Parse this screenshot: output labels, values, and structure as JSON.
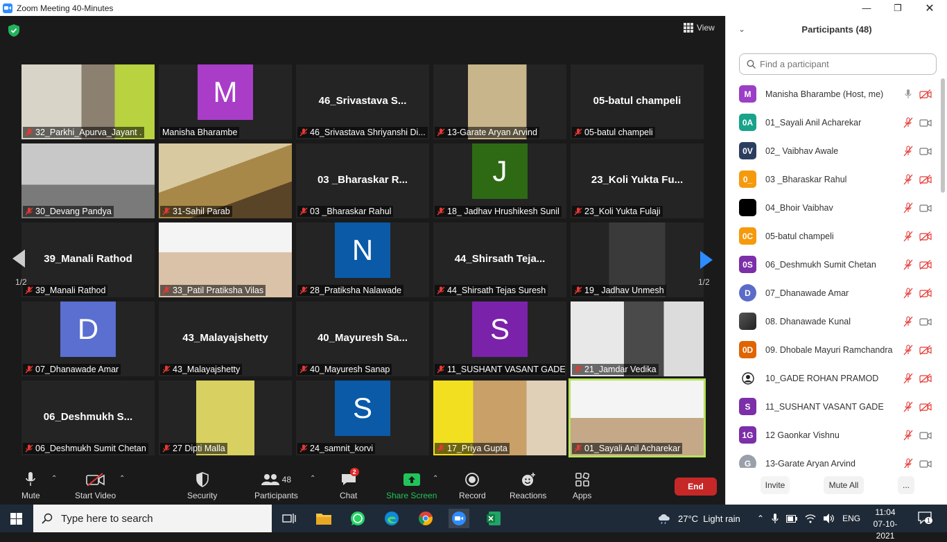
{
  "window": {
    "title": "Zoom Meeting 40-Minutes"
  },
  "view_label": "View",
  "page_indicator": "1/2",
  "tiles": [
    {
      "caption": "32_Parkhi_Apurva_Jayant ."
    },
    {
      "caption": "Manisha Bharambe",
      "initial": "M"
    },
    {
      "caption": "46_Srivastava Shriyanshi Di...",
      "big": "46_Srivastava  S..."
    },
    {
      "caption": "13-Garate Aryan Arvind"
    },
    {
      "caption": "05-batul champeli",
      "big": "05-batul champeli"
    },
    {
      "caption": "30_Devang Pandya"
    },
    {
      "caption": "31-Sahil Parab"
    },
    {
      "caption": "03 _Bharaskar Rahul",
      "big": "03 _Bharaskar R..."
    },
    {
      "caption": "18_ Jadhav Hrushikesh Sunil",
      "initial": "J"
    },
    {
      "caption": "23_Koli Yukta Fulaji",
      "big": "23_Koli Yukta Fu..."
    },
    {
      "caption": "39_Manali Rathod",
      "big": "39_Manali Rathod"
    },
    {
      "caption": "33_Patil Pratiksha Vilas"
    },
    {
      "caption": "28_Pratiksha Nalawade",
      "initial": "N"
    },
    {
      "caption": "44_Shirsath Tejas Suresh",
      "big": "44_Shirsath  Teja..."
    },
    {
      "caption": "19_ Jadhav Unmesh"
    },
    {
      "caption": "07_Dhanawade Amar",
      "initial": "D"
    },
    {
      "caption": "43_Malayajshetty",
      "big": "43_Malayajshetty"
    },
    {
      "caption": "40_Mayuresh Sanap",
      "big": "40_Mayuresh  Sa..."
    },
    {
      "caption": "11_SUSHANT VASANT GADE",
      "initial": "S"
    },
    {
      "caption": "21_Jamdar Vedika"
    },
    {
      "caption": "06_Deshmukh Sumit Chetan",
      "big": "06_Deshmukh  S..."
    },
    {
      "caption": "27 Dipti Malla"
    },
    {
      "caption": "24_samnit_korvi",
      "initial": "S"
    },
    {
      "caption": "17_Priya Gupta"
    },
    {
      "caption": "01_Sayali Anil Acharekar"
    }
  ],
  "toolbar": {
    "mute": "Mute",
    "start_video": "Start Video",
    "security": "Security",
    "participants": "Participants",
    "participants_count": "48",
    "chat": "Chat",
    "chat_badge": "2",
    "share_screen": "Share Screen",
    "record": "Record",
    "reactions": "Reactions",
    "apps": "Apps",
    "end": "End"
  },
  "panel": {
    "title": "Participants (48)",
    "search_placeholder": "Find a participant",
    "invite": "Invite",
    "mute_all": "Mute All",
    "more": "...",
    "participants": [
      {
        "initials": "M",
        "name": "Manisha Bharambe (Host, me)",
        "color": "#9b3fc6"
      },
      {
        "initials": "0A",
        "name": "01_Sayali Anil Acharekar",
        "color": "#18a38a"
      },
      {
        "initials": "0V",
        "name": "02_ Vaibhav Awale",
        "color": "#2c3e60"
      },
      {
        "initials": "0_",
        "name": "03 _Bharaskar Rahul",
        "color": "#f59a0c"
      },
      {
        "initials": "",
        "name": "04_Bhoir Vaibhav",
        "color": "#000000"
      },
      {
        "initials": "0C",
        "name": "05-batul champeli",
        "color": "#f59a0c"
      },
      {
        "initials": "0S",
        "name": "06_Deshmukh Sumit Chetan",
        "color": "#7b2fa8"
      },
      {
        "initials": "D",
        "name": "07_Dhanawade Amar",
        "color": "#5b6bc8"
      },
      {
        "initials": "",
        "name": "08. Dhanawade Kunal",
        "color": "#444444"
      },
      {
        "initials": "0D",
        "name": "09. Dhobale Mayuri Ramchandra",
        "color": "#e06400"
      },
      {
        "initials": "",
        "name": "10_GADE ROHAN PRAMOD",
        "color": "#ffffff"
      },
      {
        "initials": "S",
        "name": "11_SUSHANT VASANT GADE",
        "color": "#7b2fa8"
      },
      {
        "initials": "1G",
        "name": "12 Gaonkar Vishnu",
        "color": "#7b2fa8"
      },
      {
        "initials": "G",
        "name": "13-Garate Aryan Arvind",
        "color": "#9aa0aa"
      }
    ]
  },
  "taskbar": {
    "search_placeholder": "Type here to search",
    "weather": "27°C  Light rain",
    "lang": "ENG",
    "time": "11:04",
    "date": "07-10-2021",
    "notif_count": "1"
  }
}
